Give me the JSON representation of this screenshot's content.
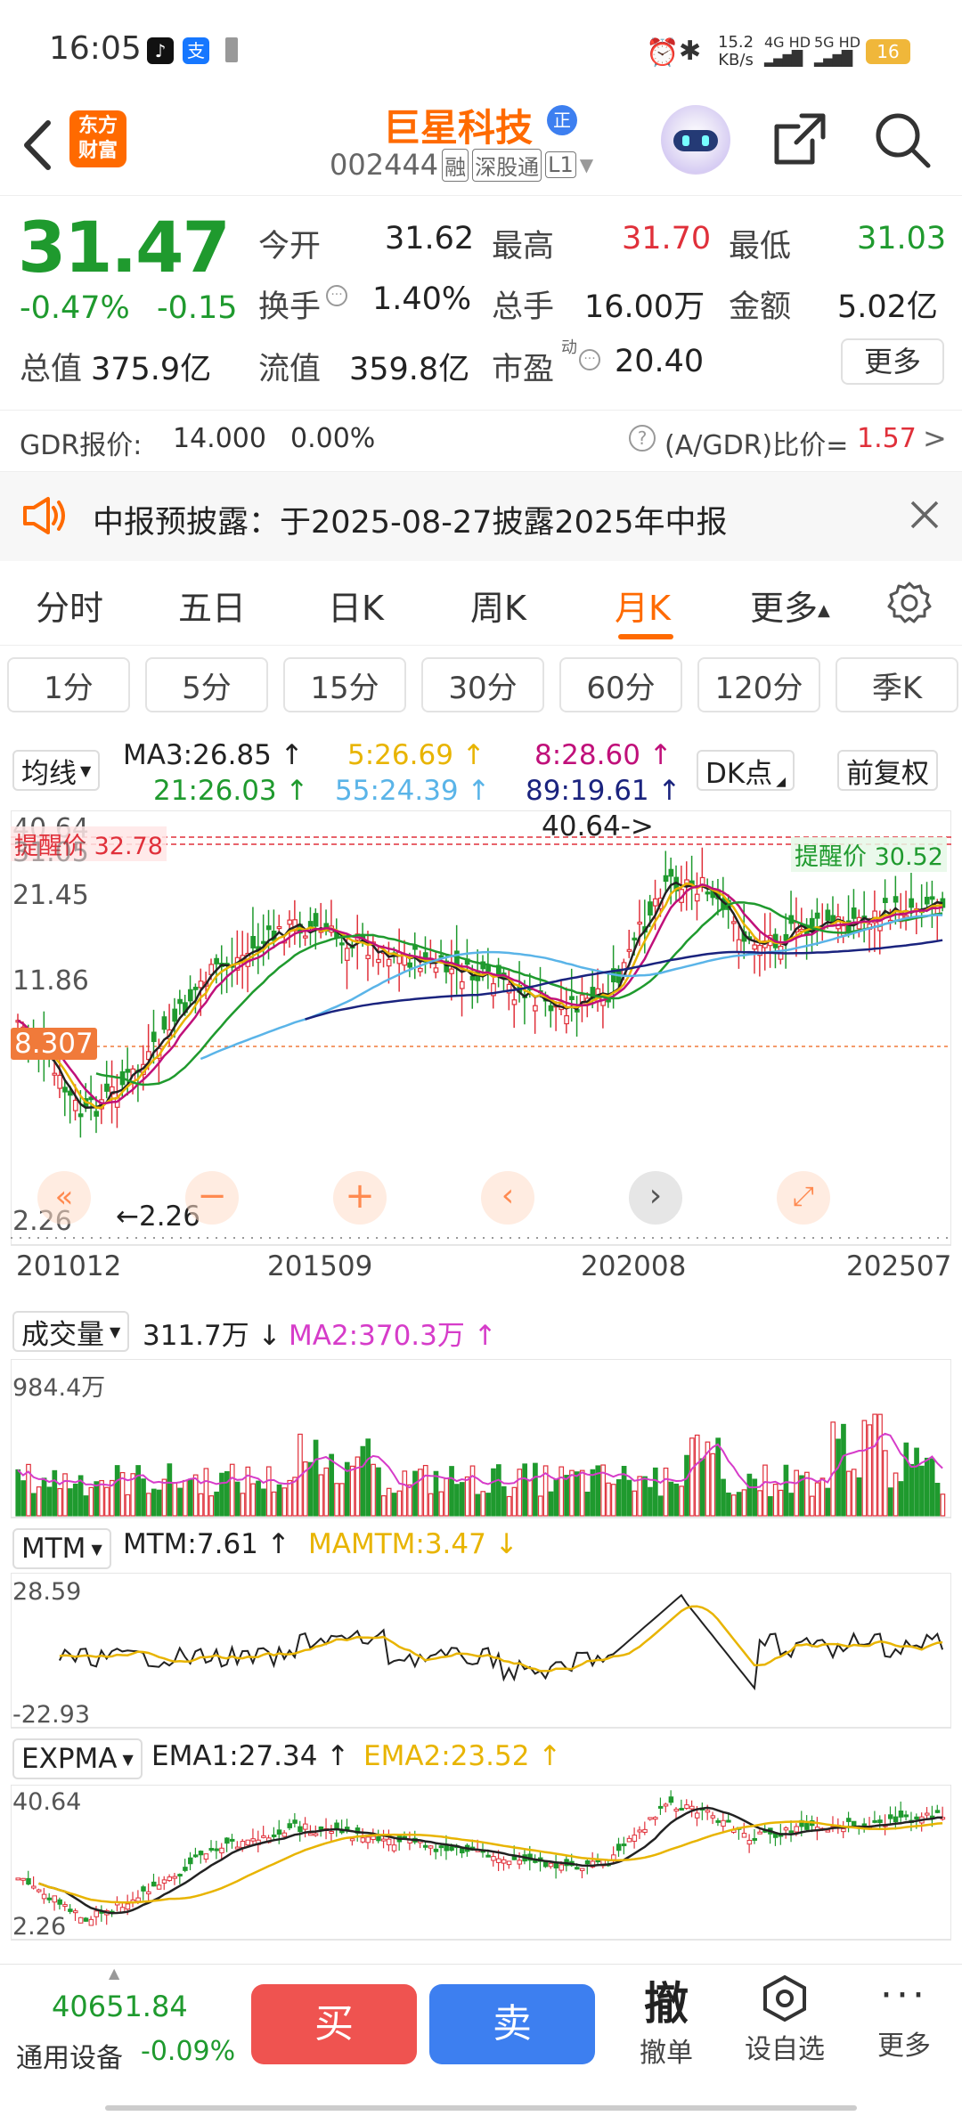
{
  "status": {
    "time": "16:05",
    "net_speed": "15.2",
    "net_unit": "KB/s",
    "sig1": "4G HD",
    "sig2": "5G HD",
    "battery": "16"
  },
  "nav": {
    "logo_line1": "东方",
    "logo_line2": "财富",
    "stock_name": "巨星科技",
    "zheng_badge": "正",
    "code": "002444",
    "tags": [
      "融",
      "深股通",
      "L1"
    ]
  },
  "quote": {
    "price": "31.47",
    "pct": "-0.47%",
    "chg": "-0.15",
    "open_label": "今开",
    "open": "31.62",
    "high_label": "最高",
    "high": "31.70",
    "low_label": "最低",
    "low": "31.03",
    "turnover_label": "换手",
    "turnover": "1.40%",
    "vol_label": "总手",
    "vol": "16.00万",
    "amt_label": "金额",
    "amt": "5.02亿",
    "mcap_label": "总值",
    "mcap": "375.9亿",
    "float_label": "流值",
    "float": "359.8亿",
    "pe_label": "市盈",
    "pe_sup": "动",
    "pe": "20.40",
    "more": "更多"
  },
  "gdr": {
    "label": "GDR报价:",
    "price": "14.000",
    "pct": "0.00%",
    "ratio_label": "(A/GDR)比价=",
    "ratio": "1.57"
  },
  "notice": {
    "text": "中报预披露：于2025-08-27披露2025年中报"
  },
  "tabs": [
    "分时",
    "五日",
    "日K",
    "周K",
    "月K",
    "更多"
  ],
  "periods": [
    "1分",
    "5分",
    "15分",
    "30分",
    "60分",
    "120分",
    "季K"
  ],
  "ma_header": {
    "select": "均线",
    "ma3": "MA3:26.85",
    "ma5": "5:26.69",
    "ma8": "8:28.60",
    "ma21": "21:26.03",
    "ma55": "55:24.39",
    "ma89": "89:19.61",
    "dk": "DK点",
    "fq": "前复权"
  },
  "main_chart": {
    "max_label": "40.64",
    "peak_note": "40.64->",
    "alert_left": "提醒价 32.78",
    "price_2": "31.05",
    "price_3": "21.45",
    "price_4": "11.86",
    "current_tag": "8.307",
    "min_label": "2.26",
    "low_note": "←2.26",
    "alert_right": "提醒价 30.52",
    "dates": [
      "201012",
      "201509",
      "202008",
      "202507"
    ]
  },
  "volume": {
    "select": "成交量",
    "val": "311.7万",
    "ma2": "MA2:370.3万",
    "max": "984.4万"
  },
  "mtm": {
    "select": "MTM",
    "val": "MTM:7.61",
    "mamtm": "MAMTM:3.47",
    "max": "28.59",
    "min": "-22.93"
  },
  "expma": {
    "select": "EXPMA",
    "ema1": "EMA1:27.34",
    "ema2": "EMA2:23.52",
    "max": "40.64",
    "min": "2.26"
  },
  "bottom": {
    "index_val": "40651.84",
    "index_name": "通用设备",
    "index_pct": "-0.09%",
    "buy": "买",
    "sell": "卖",
    "cancel_big": "撤",
    "cancel": "撤单",
    "fav": "设自选",
    "more": "更多"
  },
  "colors": {
    "up": "#e0303a",
    "down": "#1f9a2e",
    "ma3": "#222222",
    "ma5": "#e8b400",
    "ma8": "#c0107a",
    "ma21": "#1f9a2e",
    "ma55": "#5ab4e8",
    "ma89": "#1a237e",
    "brand": "#ff6a00",
    "buy": "#ef5350",
    "sell": "#3d7ff0"
  }
}
